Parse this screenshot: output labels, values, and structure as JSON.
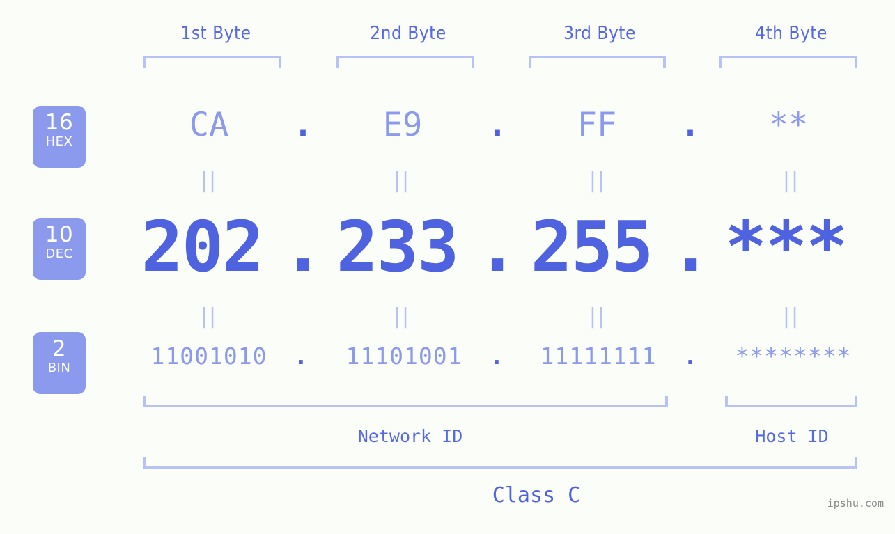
{
  "page": {
    "background_color": "#fbfdf8",
    "accent_strong": "#4f63e0",
    "accent_light": "#8b9aec",
    "accent_pale": "#b8c2f7",
    "watermark": "ipshu.com"
  },
  "byte_headers": [
    {
      "label": "1st Byte"
    },
    {
      "label": "2nd Byte"
    },
    {
      "label": "3rd Byte"
    },
    {
      "label": "4th Byte"
    }
  ],
  "radix_badges": [
    {
      "number": "16",
      "word": "HEX"
    },
    {
      "number": "10",
      "word": "DEC"
    },
    {
      "number": "2",
      "word": "BIN"
    }
  ],
  "rows": {
    "hex": {
      "values": [
        "CA",
        "E9",
        "FF",
        "**"
      ],
      "separators": [
        ".",
        ".",
        "."
      ]
    },
    "dec": {
      "values": [
        "202",
        "233",
        "255",
        "***"
      ],
      "separators": [
        ".",
        ".",
        "."
      ]
    },
    "bin": {
      "values": [
        "11001010",
        "11101001",
        "11111111",
        "********"
      ],
      "separators": [
        ".",
        ".",
        "."
      ]
    }
  },
  "equals_marks": {
    "glyph": "||",
    "count_per_gap": 4
  },
  "id_sections": [
    {
      "label": "Network ID"
    },
    {
      "label": "Host ID"
    }
  ],
  "class_label": "Class C"
}
